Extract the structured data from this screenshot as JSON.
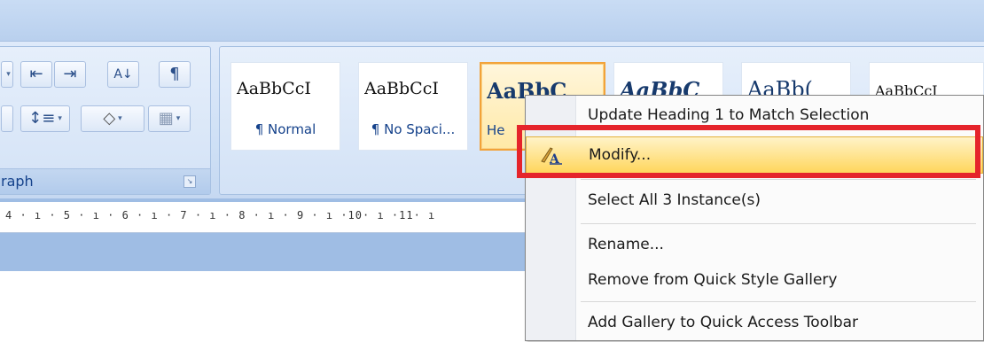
{
  "paragraph_group": {
    "label": "raph",
    "pilcrow_icon": "¶"
  },
  "styles": [
    {
      "sample": "AaBbCcI",
      "name": "¶ Normal"
    },
    {
      "sample": "AaBbCcI",
      "name": "¶ No Spaci..."
    },
    {
      "sample": "AaBbC",
      "name": "He"
    },
    {
      "sample": "AaBbC",
      "name": ""
    },
    {
      "sample": "AaBb(",
      "name": ""
    },
    {
      "sample": "AaBbCcI",
      "name": ""
    }
  ],
  "ruler": {
    "text": "4 · ı · 5 · ı · 6 · ı · 7 · ı · 8 · ı · 9 · ı ·10· ı ·11· ı"
  },
  "context_menu": {
    "items": [
      {
        "label": "Update Heading 1 to Match Selection"
      },
      {
        "label": "Modify...",
        "icon": "modify-style-icon"
      },
      {
        "label": "Select All 3 Instance(s)"
      },
      {
        "label": "Rename..."
      },
      {
        "label": "Remove from Quick Style Gallery"
      },
      {
        "label": "Add Gallery to Quick Access Toolbar"
      }
    ]
  },
  "colors": {
    "highlight": "#e5242b",
    "hover": "#ffd65c"
  }
}
